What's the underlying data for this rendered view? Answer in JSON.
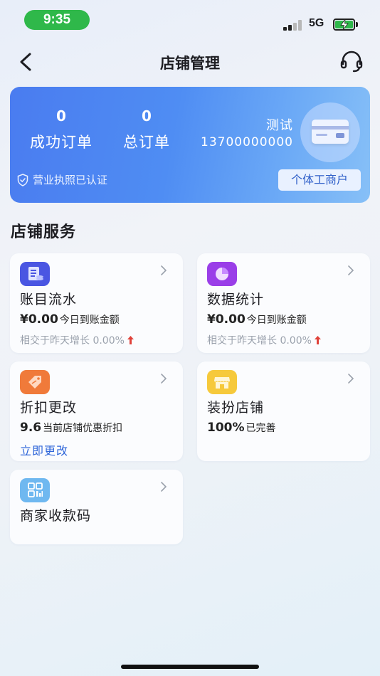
{
  "status_bar": {
    "time": "9:35",
    "network": "5G",
    "signal_strength_bars": 2,
    "battery_charging": true
  },
  "nav": {
    "title": "店铺管理",
    "back_icon": "chevron-left-icon",
    "right_icon": "headset-icon"
  },
  "shop_card": {
    "success_orders_value": "0",
    "success_orders_label": "成功订单",
    "total_orders_value": "0",
    "total_orders_label": "总订单",
    "shop_name": "测试",
    "phone": "13700000000",
    "license_status": "营业执照已认证",
    "business_type": "个体工商户",
    "card_icon": "bank-card-icon"
  },
  "section_title": "店铺服务",
  "services": [
    {
      "name": "账目流水",
      "icon": "ledger-icon",
      "icon_color": "#4a56e2",
      "amount": "¥0.00",
      "amount_label": "今日到账金额",
      "sub": "相交于昨天增长 0.00%"
    },
    {
      "name": "数据统计",
      "icon": "pie-chart-icon",
      "icon_color": "#9a3ee8",
      "amount": "¥0.00",
      "amount_label": "今日到账金额",
      "sub": "相交于昨天增长 0.00%"
    },
    {
      "name": "折扣更改",
      "icon": "discount-tag-icon",
      "icon_color": "#f07a3a",
      "amount": "9.6",
      "amount_label": "当前店铺优惠折扣",
      "link": "立即更改"
    },
    {
      "name": "装扮店铺",
      "icon": "storefront-icon",
      "icon_color": "#f6c93b",
      "amount": "100%",
      "amount_label": "已完善"
    },
    {
      "name": "商家收款码",
      "icon": "qr-code-icon",
      "icon_color": "#6fb8f0"
    }
  ],
  "colors": {
    "banner_start": "#4a7cf0",
    "banner_end": "#87c0f7",
    "accent_link": "#2f66d9",
    "up_arrow": "#e0423a",
    "status_pill": "#2fb84a"
  }
}
